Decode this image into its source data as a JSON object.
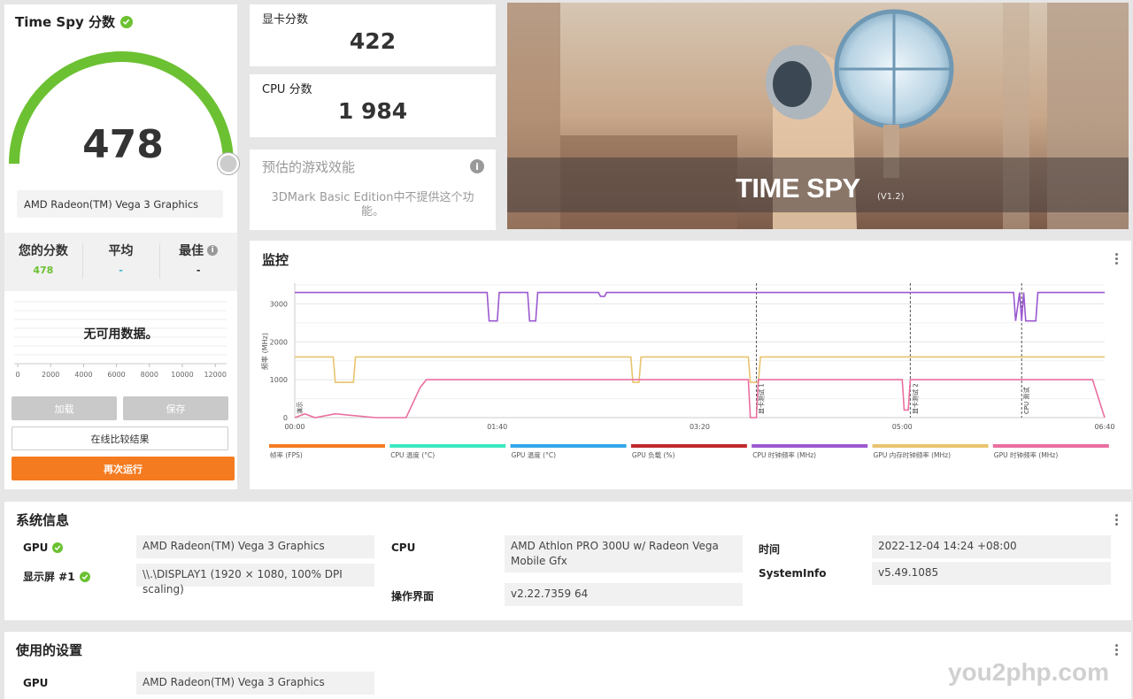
{
  "score_card": {
    "title": "Time Spy 分数",
    "score": "478",
    "gpu_name": "AMD Radeon(TM) Vega 3 Graphics",
    "stats": [
      {
        "label": "您的分数",
        "value": "478",
        "color": "#6cc132"
      },
      {
        "label": "平均",
        "value": "-",
        "color": "#2fb5c9"
      },
      {
        "label": "最佳",
        "value": "-",
        "color": "#222222"
      }
    ],
    "histogram_ticks": [
      "0",
      "2000",
      "4000",
      "6000",
      "8000",
      "10000",
      "12000"
    ],
    "no_data": "无可用数据。",
    "buttons": {
      "load": "加载",
      "save": "保存",
      "compare": "在线比较结果",
      "run": "再次运行"
    }
  },
  "sub_scores": [
    {
      "label": "显卡分数",
      "value": "422"
    },
    {
      "label": "CPU 分数",
      "value": "1 984"
    }
  ],
  "performance": {
    "title": "预估的游戏效能",
    "description": "3DMark Basic Edition中不提供这个功能。"
  },
  "hero": {
    "title": "TIME SPY",
    "version": "(V1.2)"
  },
  "monitor": {
    "title": "监控",
    "y_axis_label": "频率 (MHz)",
    "y_ticks": [
      "0",
      "1000",
      "2000",
      "3000"
    ],
    "x_ticks": [
      "00:00",
      "01:40",
      "03:20",
      "05:00",
      "06:40"
    ],
    "markers": [
      "演示",
      "显卡测试 1",
      "显卡测试 2",
      "CPU 测试"
    ],
    "legend": [
      {
        "label": "帧率 (FPS)",
        "color": "#f47b20"
      },
      {
        "label": "CPU 温度 (°C)",
        "color": "#3de8c2"
      },
      {
        "label": "GPU 温度 (°C)",
        "color": "#31a7e8"
      },
      {
        "label": "GPU 负载 (%)",
        "color": "#c0282d"
      },
      {
        "label": "CPU 时钟频率 (MHz)",
        "color": "#9b59d0"
      },
      {
        "label": "GPU 内存时钟频率 (MHz)",
        "color": "#e8c46e"
      },
      {
        "label": "GPU 时钟频率 (MHz)",
        "color": "#ea6fa0"
      }
    ]
  },
  "chart_data": {
    "type": "line",
    "title": "",
    "xlabel": "",
    "ylabel": "频率 (MHz)",
    "xlim": [
      "00:00",
      "06:40"
    ],
    "ylim": [
      0,
      3500
    ],
    "grid": true,
    "legend_placement": "bottom",
    "series": [
      {
        "name": "CPU 时钟频率 (MHz)",
        "x_seconds": [
          0,
          95,
          96,
          100,
          101,
          115,
          116,
          119,
          120,
          150,
          151,
          153,
          154,
          355,
          356,
          358,
          359,
          360,
          361,
          366,
          367,
          400
        ],
        "values": [
          3300,
          3300,
          2550,
          2550,
          3300,
          3300,
          2550,
          2550,
          3300,
          3300,
          3200,
          3200,
          3300,
          3300,
          2550,
          3300,
          2550,
          3300,
          2550,
          2550,
          3300,
          3300
        ]
      },
      {
        "name": "GPU 内存时钟频率 (MHz)",
        "x_seconds": [
          0,
          19,
          20,
          29,
          30,
          166,
          167,
          170,
          171,
          224,
          225,
          229,
          230,
          400
        ],
        "values": [
          1600,
          1600,
          930,
          930,
          1600,
          1600,
          930,
          930,
          1600,
          1600,
          930,
          930,
          1600,
          1600
        ]
      },
      {
        "name": "GPU 时钟频率 (MHz)",
        "x_seconds": [
          0,
          5,
          10,
          20,
          40,
          55,
          62,
          65,
          224,
          225,
          228,
          229,
          300,
          301,
          303,
          304,
          394,
          400
        ],
        "values": [
          0,
          100,
          0,
          100,
          0,
          0,
          800,
          1000,
          1000,
          0,
          0,
          1000,
          1000,
          200,
          200,
          1000,
          1000,
          0
        ]
      }
    ]
  },
  "system_info": {
    "title": "系统信息",
    "gpu_label": "GPU",
    "gpu_value": "AMD Radeon(TM) Vega 3 Graphics",
    "display_label": "显示屏 #1",
    "display_value": "\\\\.\\DISPLAY1 (1920 × 1080, 100% DPI scaling)",
    "cpu_label": "CPU",
    "cpu_value": "AMD Athlon PRO 300U w/ Radeon Vega Mobile Gfx",
    "os_label": "操作界面",
    "os_value": "v2.22.7359 64",
    "time_label": "时间",
    "time_value": "2022-12-04 14:24 +08:00",
    "sysinfo_label": "SystemInfo",
    "sysinfo_value": "v5.49.1085"
  },
  "used_settings": {
    "title": "使用的设置",
    "gpu_label": "GPU",
    "gpu_value": "AMD Radeon(TM) Vega 3 Graphics"
  },
  "watermark": "you2php.com"
}
